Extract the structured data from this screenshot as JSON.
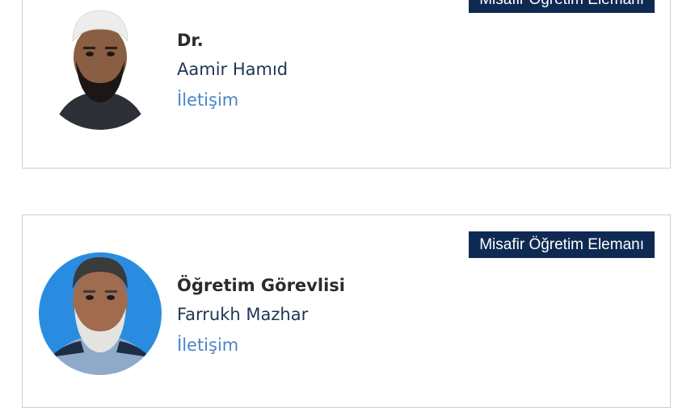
{
  "staff": [
    {
      "badge": "Misafir Öğretim Elemanı",
      "title": "Dr.",
      "name": "Aamir Hamıd",
      "contact": "İletişim",
      "photo_background": "#ffffff"
    },
    {
      "badge": "Misafir Öğretim Elemanı",
      "title": "Öğretim Görevlisi",
      "name": "Farrukh Mazhar",
      "contact": "İletişim",
      "photo_background": "#2a8ce0"
    }
  ],
  "colors": {
    "badge_bg": "#0f2a52",
    "link": "#4a86c8",
    "name": "#1f3556"
  }
}
